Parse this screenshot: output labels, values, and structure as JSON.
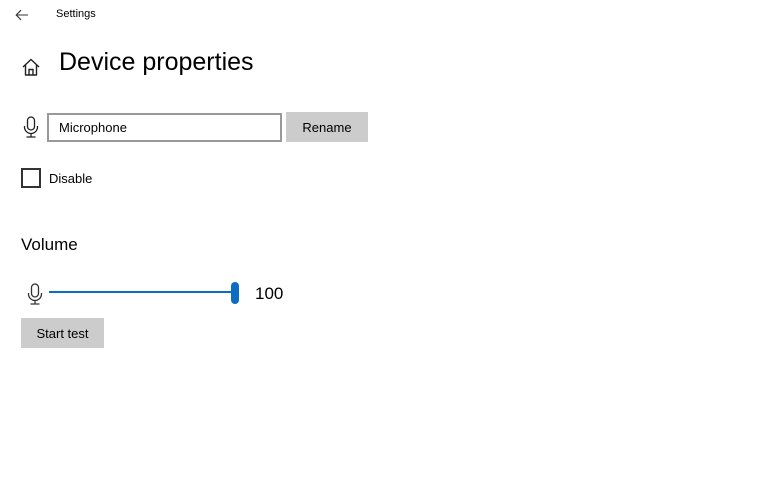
{
  "window": {
    "title": "Settings",
    "back_icon": "back-arrow-icon"
  },
  "header": {
    "home_icon": "home-icon",
    "title": "Device properties"
  },
  "device": {
    "icon": "microphone-icon",
    "name_value": "Microphone",
    "rename_label": "Rename"
  },
  "disable": {
    "label": "Disable",
    "checked": false
  },
  "volume": {
    "heading": "Volume",
    "icon": "microphone-icon",
    "value": 100,
    "value_label": "100",
    "min": 0,
    "max": 100,
    "accent_color": "#0a6cc2"
  },
  "test": {
    "start_label": "Start test"
  }
}
